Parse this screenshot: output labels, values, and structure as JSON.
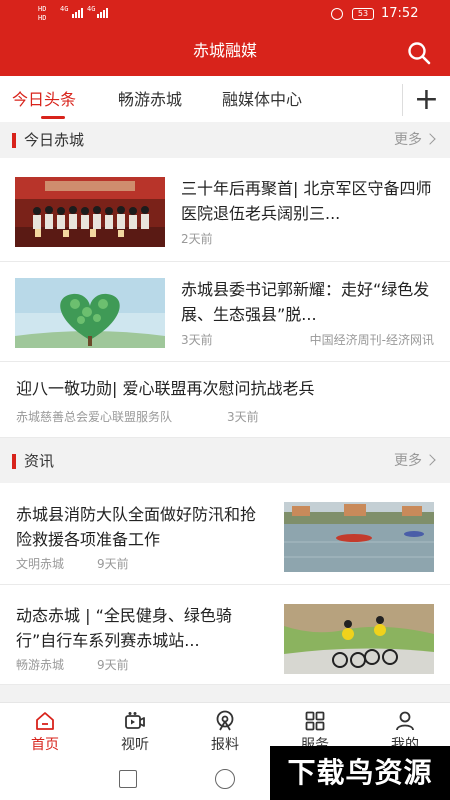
{
  "status_bar": {
    "sim1": "HD",
    "sim2": "HD",
    "network1": "4G",
    "network2": "4G",
    "battery": "53",
    "time": "17:52"
  },
  "header": {
    "title": "赤城融媒",
    "brand_color": "#d8231b"
  },
  "tabs": [
    {
      "label": "今日头条",
      "active": true
    },
    {
      "label": "畅游赤城",
      "active": false
    },
    {
      "label": "融媒体中心",
      "active": false
    }
  ],
  "add_tab_symbol": "+",
  "sections": [
    {
      "title": "今日赤城",
      "more": "更多",
      "items": [
        {
          "headline": "三十年后再聚首| 北京军区守备四师医院退伍老兵阔别三...",
          "time": "2天前",
          "source": ""
        },
        {
          "headline": "赤城县委书记郭新耀：走好“绿色发展、生态强县”脱...",
          "time": "3天前",
          "source": "中国经济周刊-经济网讯"
        },
        {
          "headline": "迎八一敬功勋| 爱心联盟再次慰问抗战老兵",
          "time": "3天前",
          "source": "赤城慈善总会爱心联盟服务队"
        }
      ]
    },
    {
      "title": "资讯",
      "more": "更多",
      "items": [
        {
          "headline": "赤城县消防大队全面做好防汛和抢险救援各项准备工作",
          "time": "9天前",
          "source": "文明赤城"
        },
        {
          "headline": "动态赤城 | “全民健身、绿色骑行”自行车系列赛赤城站...",
          "time": "9天前",
          "source": "畅游赤城"
        }
      ]
    }
  ],
  "bottom_nav": [
    {
      "label": "首页",
      "icon": "home-icon",
      "active": true
    },
    {
      "label": "视听",
      "icon": "video-icon",
      "active": false
    },
    {
      "label": "报料",
      "icon": "broadcast-icon",
      "active": false
    },
    {
      "label": "服务",
      "icon": "grid-icon",
      "active": false
    },
    {
      "label": "我的",
      "icon": "user-icon",
      "active": false
    }
  ],
  "watermark": "下载鸟资源"
}
